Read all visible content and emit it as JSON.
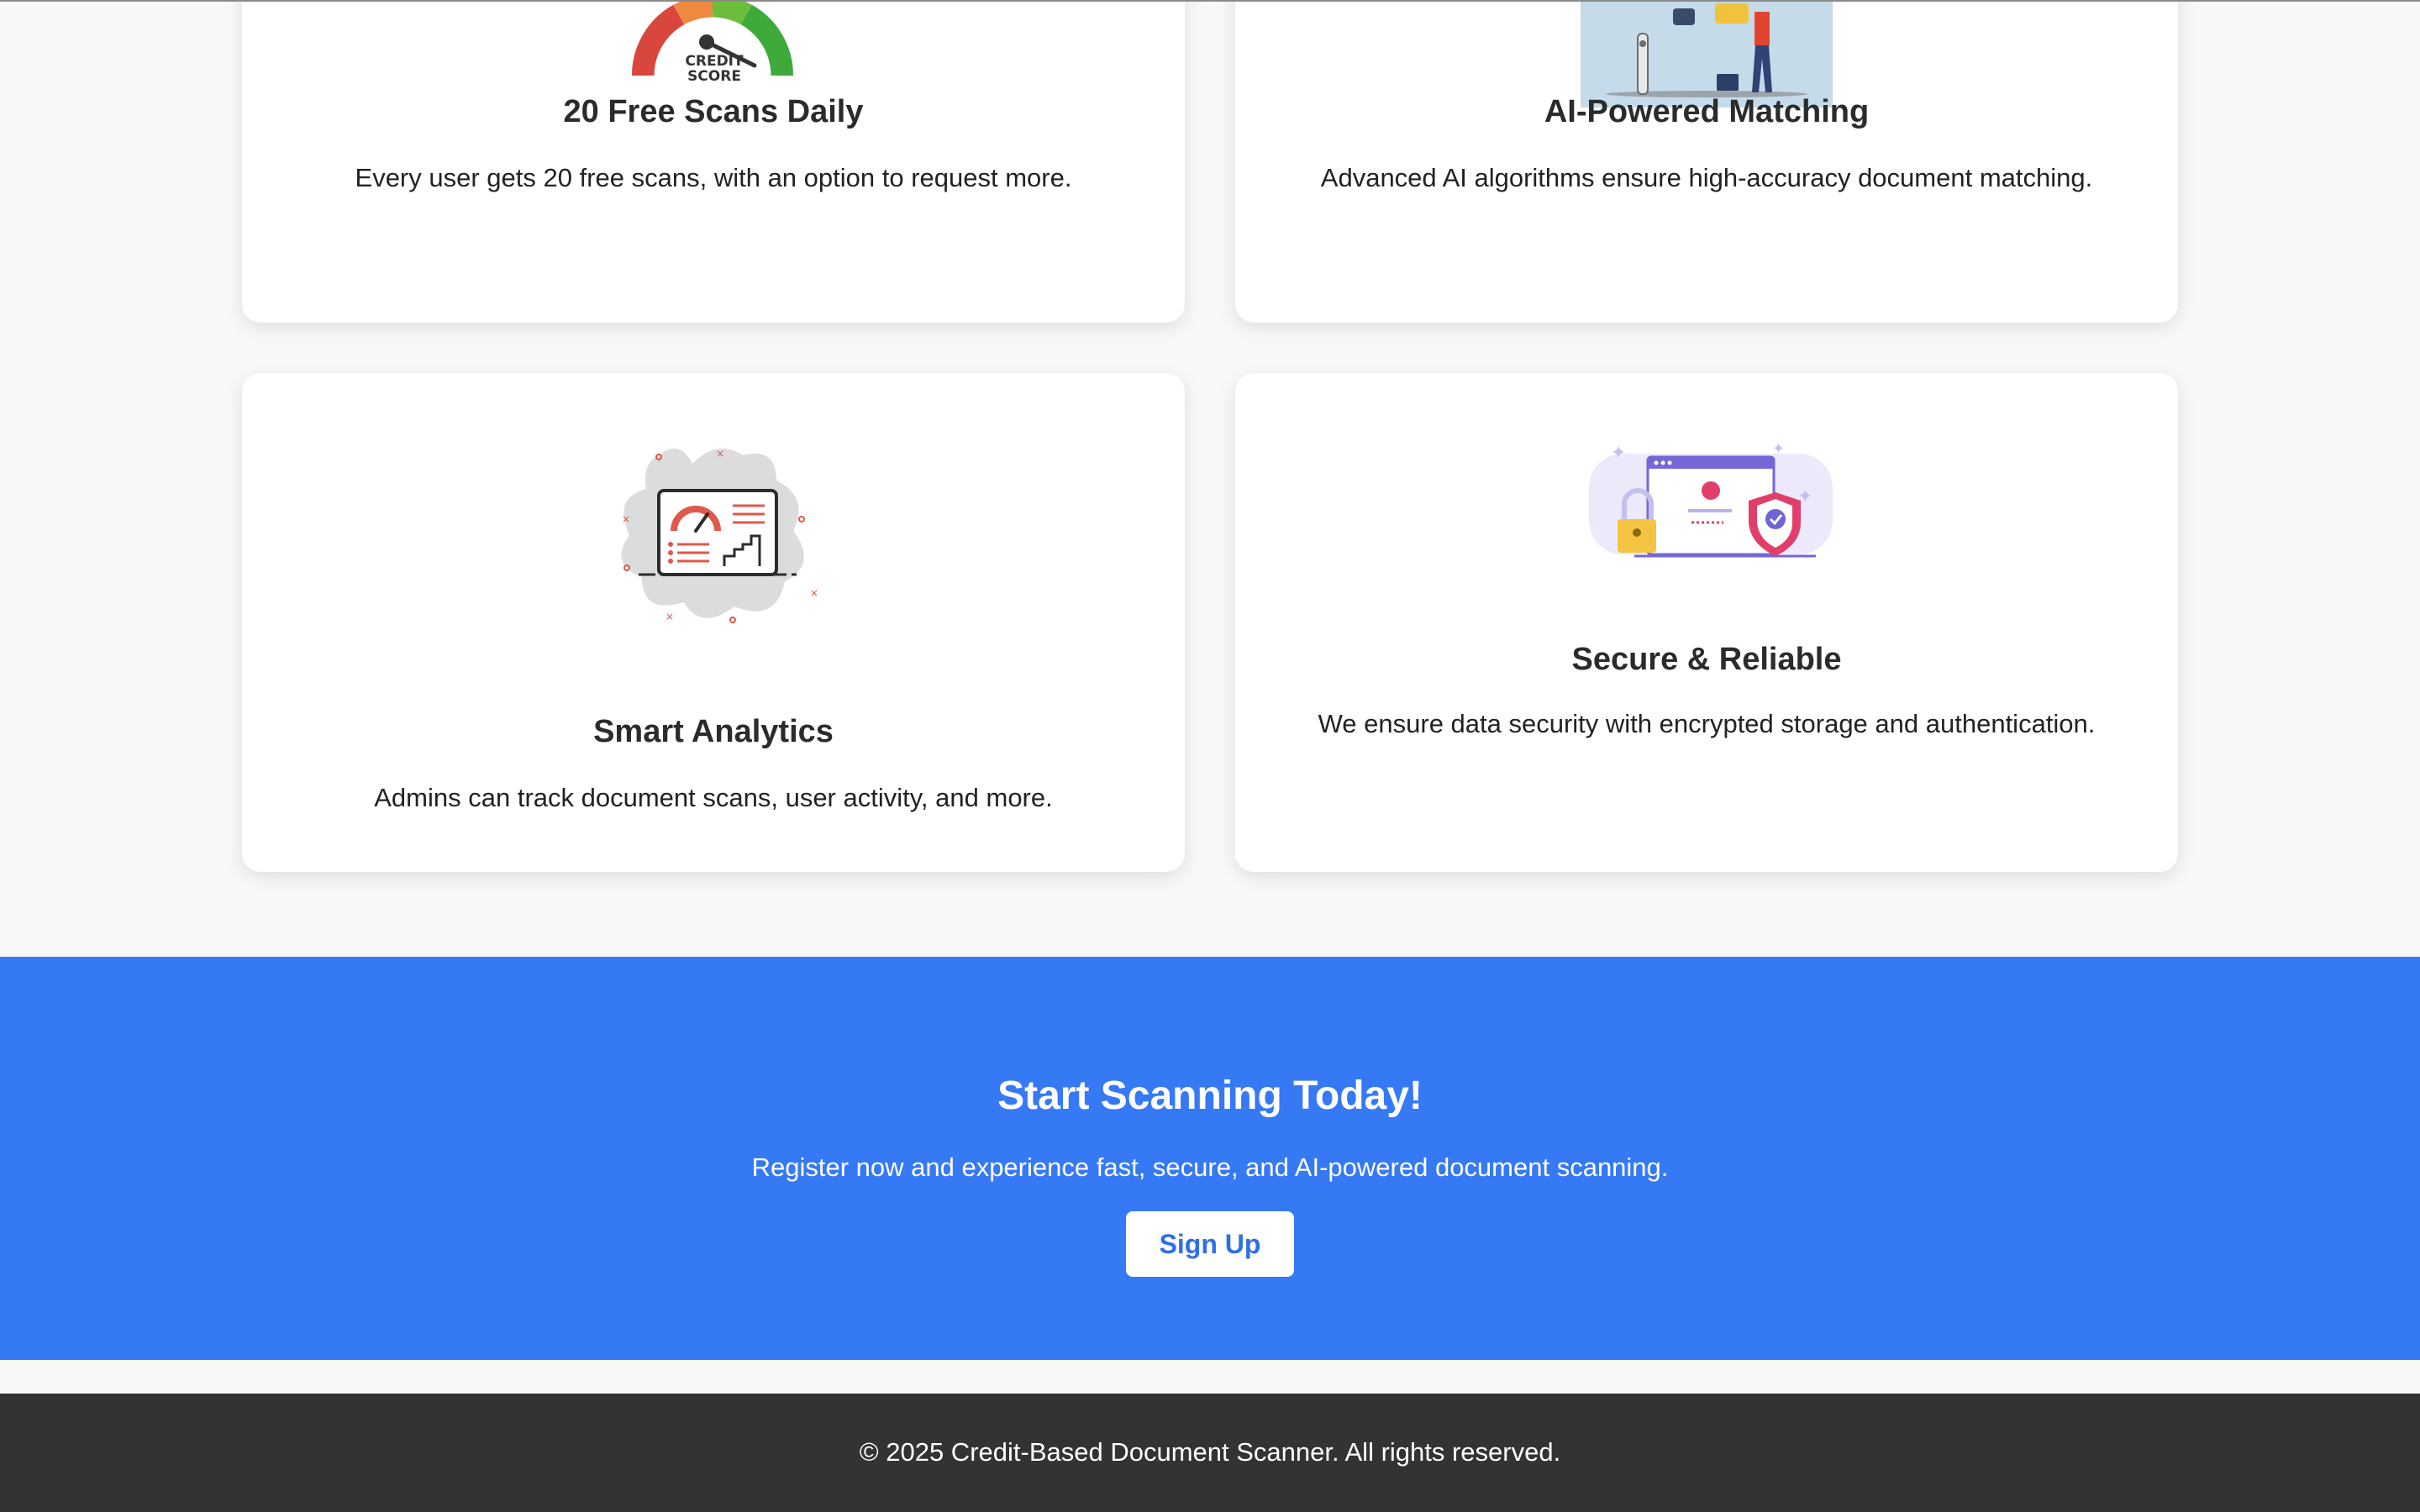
{
  "features": [
    {
      "title": "20 Free Scans Daily",
      "description": "Every user gets 20 free scans, with an option to request more.",
      "icon": "credit-score-gauge"
    },
    {
      "title": "AI-Powered Matching",
      "description": "Advanced AI algorithms ensure high-accuracy document matching.",
      "icon": "ai-robot-illustration"
    },
    {
      "title": "Smart Analytics",
      "description": "Admins can track document scans, user activity, and more.",
      "icon": "analytics-dashboard"
    },
    {
      "title": "Secure & Reliable",
      "description": "We ensure data security with encrypted storage and authentication.",
      "icon": "security-shield-lock"
    }
  ],
  "gauge_text": {
    "line1": "CREDIT",
    "line2": "SCORE"
  },
  "cta": {
    "title": "Start Scanning Today!",
    "subtitle": "Register now and experience fast, secure, and AI-powered document scanning.",
    "button_label": "Sign Up"
  },
  "footer": {
    "text": "© 2025 Credit-Based Document Scanner. All rights reserved."
  },
  "colors": {
    "page_bg": "#f7f8f8",
    "cta_bg": "#3679f5",
    "footer_bg": "#333333",
    "button_text": "#2f6fe6"
  }
}
